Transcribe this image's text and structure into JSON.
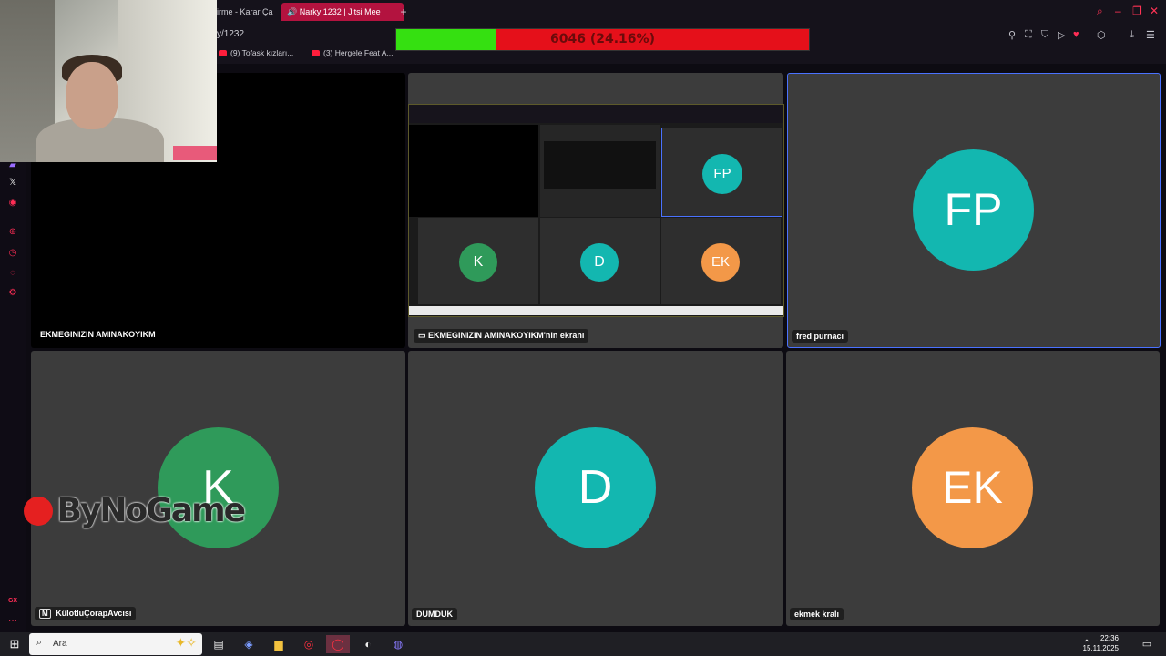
{
  "browser": {
    "tabs": [
      {
        "label": "irme - Karar Ça",
        "active": false
      },
      {
        "label": "Narky 1232 | Jitsi Mee",
        "active": true
      }
    ],
    "new_tab_icon": "+",
    "address": "y/1232",
    "bookmarks": [
      "(9) Tofask kızları...",
      "(3) Hergele Feat A..."
    ]
  },
  "progress": {
    "text": "6046 (24.16%)",
    "fraction": 0.2416,
    "fill_color": "#35e011",
    "bg_color": "#e5101a"
  },
  "meeting": {
    "tiles": [
      {
        "name": "EKMEGINIZIN AMINAKOYIKM",
        "kind": "video-off"
      },
      {
        "name": "EKMEGINIZIN AMINAKOYIKM'nin ekranı",
        "kind": "screen-share"
      },
      {
        "name": "fred purnacı",
        "initials": "FP",
        "color": "#13b7b0",
        "active": true
      },
      {
        "name": "KülotluÇorapAvcısı",
        "initials": "K",
        "color": "#2f9a5a",
        "badge": "M"
      },
      {
        "name": "DÜMDÜK",
        "initials": "D",
        "color": "#13b7b0"
      },
      {
        "name": "ekmek kralı",
        "initials": "EK",
        "color": "#f39848"
      }
    ],
    "share_preview": {
      "avatars": [
        {
          "initials": "FP",
          "color": "#13b7b0"
        },
        {
          "initials": "K",
          "color": "#2f9a5a"
        },
        {
          "initials": "D",
          "color": "#13b7b0"
        },
        {
          "initials": "EK",
          "color": "#f39848"
        }
      ]
    }
  },
  "watermark": {
    "text": "ByNoGame"
  },
  "taskbar": {
    "search_placeholder": "Ara",
    "time": "22:36",
    "date": "15.11.2025"
  }
}
